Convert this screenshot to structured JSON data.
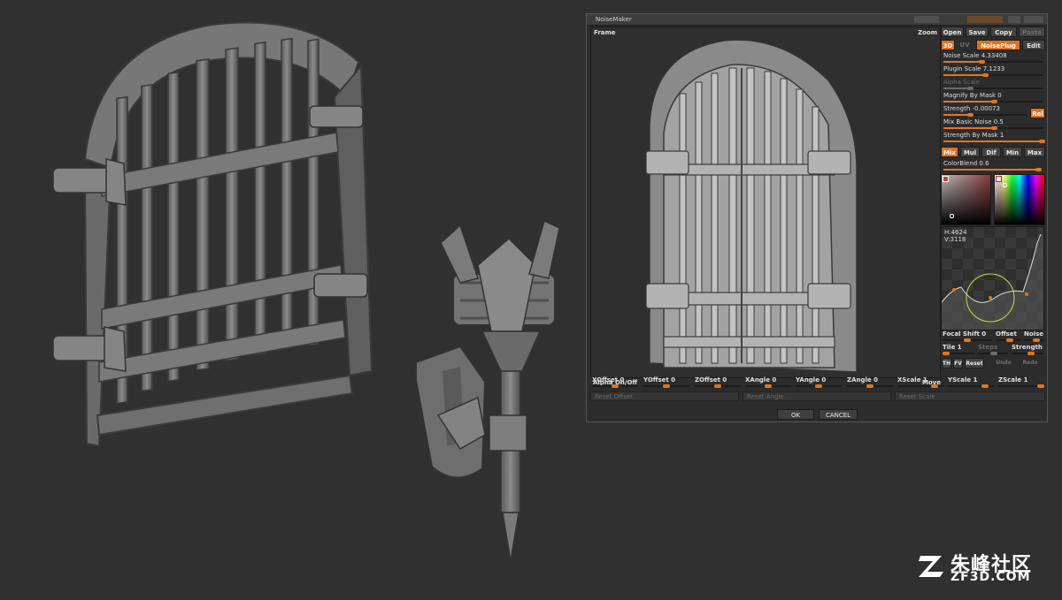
{
  "dialog": {
    "title": "NoiseMaker",
    "frame_label": "Frame",
    "zoom_label": "Zoom",
    "move_label": "Move",
    "alpha_label": "Alpha On/Off",
    "buttons": {
      "open": "Open",
      "save": "Save",
      "copy": "Copy",
      "paste": "Paste",
      "3d": "3D",
      "uv": "UV",
      "noiseplug": "NoisePlug",
      "edit": "Edit",
      "rel": "Rel",
      "mix": "Mix",
      "mul": "Mul",
      "dif": "Dif",
      "min": "Min",
      "max": "Max",
      "th": "TH",
      "fv": "FV",
      "reset": "Reset",
      "undo": "Undo",
      "redo": "Redo",
      "ok": "OK",
      "cancel": "CANCEL"
    },
    "sliders": {
      "noise_scale": "Noise Scale 4.33408",
      "plugin_scale": "Plugin Scale 7.1233",
      "alpha_scale": "Alpha Scale",
      "magnify_by_mask": "Magnify By Mask 0",
      "strength": "Strength -0.00073",
      "mix_basic_noise": "Mix Basic Noise 0.5",
      "strength_by_mask": "Strength By Mask 1",
      "colorblend": "ColorBlend 0.6",
      "focal_shift": "Focal Shift 0",
      "offset": "Offset",
      "noise": "Noise",
      "tile": "Tile 1",
      "steps": "Steps",
      "strength2": "Strength"
    },
    "readout": {
      "h": "H:4624",
      "v": "V:3118"
    },
    "transforms": [
      "XOffset 0",
      "YOffset 0",
      "ZOffset 0",
      "XAngle 0",
      "YAngle 0",
      "ZAngle 0",
      "XScale 1",
      "YScale 1",
      "ZScale 1"
    ],
    "resets": [
      "Reset Offset",
      "Reset Angle",
      "Reset Scale"
    ],
    "colors": {
      "accent": "#e4711b",
      "panel": "#2c2c2c"
    }
  },
  "watermark": {
    "cn": "朱峰社区",
    "en": "ZF3D.COM"
  }
}
